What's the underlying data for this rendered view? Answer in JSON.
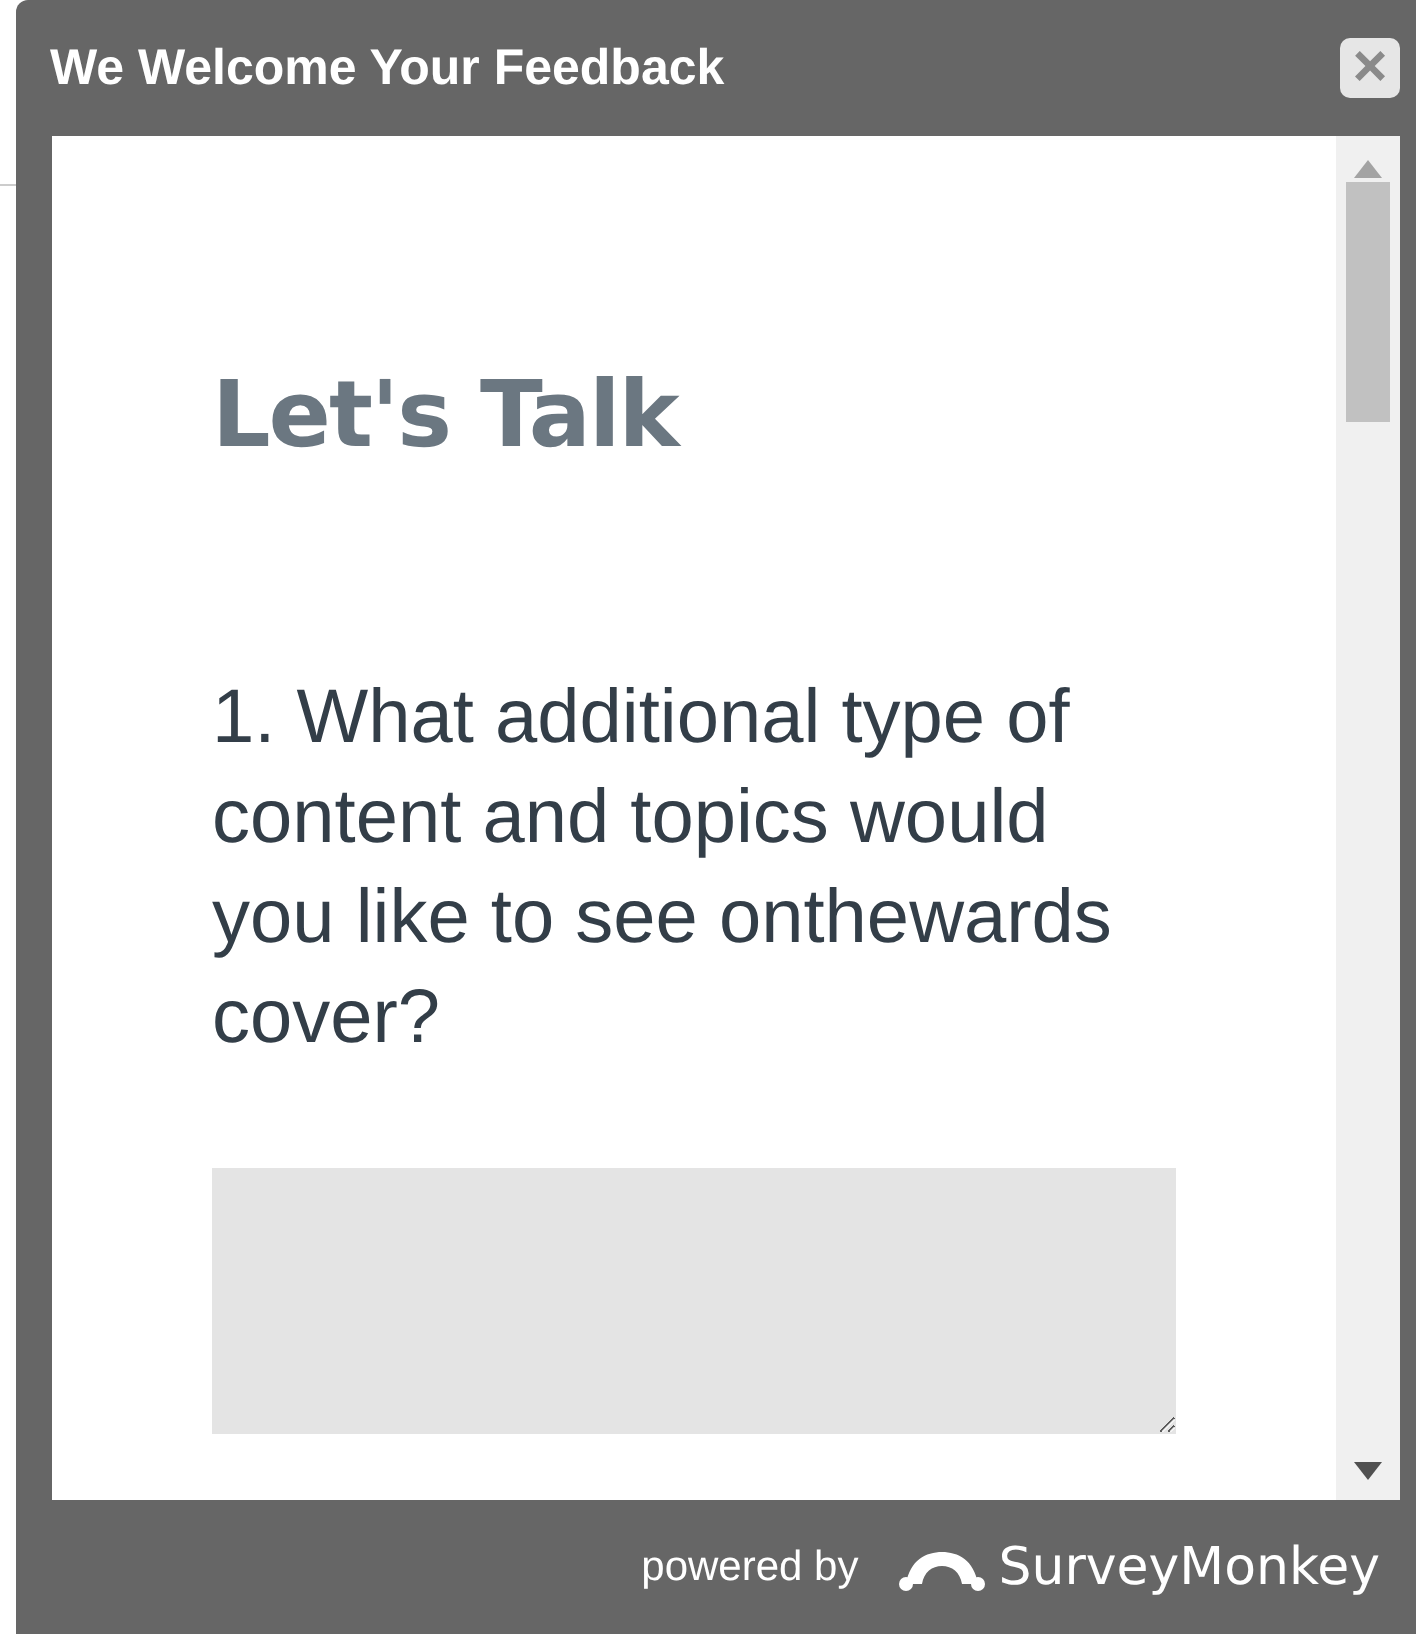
{
  "dialog": {
    "title": "We Welcome Your Feedback",
    "close": "×",
    "heading": "Let's Talk",
    "question": "1. What additional type of content and topics would you like to see onthewards cover?",
    "footer": {
      "powered_by": "powered by",
      "brand": "SurveyMonkey"
    }
  }
}
